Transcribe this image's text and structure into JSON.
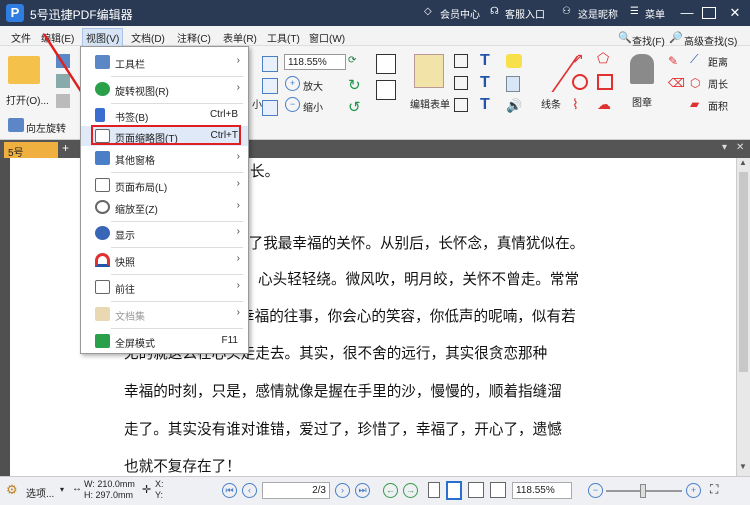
{
  "window": {
    "title": "5号迅捷PDF编辑器",
    "logo_letter": "P",
    "vip": "会员中心",
    "customer": "客服入口",
    "nickname": "这是昵称",
    "menu": "菜单"
  },
  "menubar": [
    "文件",
    "编辑(E)",
    "视图(V)",
    "文档(D)",
    "注释(C)",
    "表单(R)",
    "工具(T)",
    "窗口(W)"
  ],
  "ribbon": {
    "open": "打开(O)...",
    "zoom_value": "118.55%",
    "zoom_in": "放大",
    "zoom_out": "缩小",
    "edit_form": "编辑表单",
    "line": "线条",
    "stamp": "图章",
    "distance": "距离",
    "perimeter": "周长",
    "area": "面积",
    "find": "查找(F)",
    "advanced_find": "高级查找(S)",
    "rotate_left": "向左旋转",
    "small_label": "小"
  },
  "tab": {
    "name": "5号",
    "add": "+"
  },
  "document_lines": [
    "长。",
    "合了我最幸福的关怀。从别后，长怀念，真情犹似在。",
    "心头轻轻绕。微风吹，明月皎，关怀不曾走。常常",
    "幸福的往事，你会心的笑容，你低声的呢喃，似有若",
    "无的就这么在心头走走去。其实，很不舍的远行，其实很贪恋那种",
    "幸福的时刻，只是，感情就像是握在手里的沙，慢慢的，顺着指缝溜",
    "走了。其实没有谁对谁错，爱过了，珍惜了，幸福了，开心了，遗憾",
    "也就不复存在了！"
  ],
  "dropdown": {
    "items": [
      {
        "label": "工具栏",
        "shortcut": "",
        "arrow": "›"
      },
      {
        "label": "旋转视图(R)",
        "shortcut": "",
        "arrow": "›"
      },
      {
        "label": "书签(B)",
        "shortcut": "Ctrl+B",
        "arrow": ""
      },
      {
        "label": "页面缩略图(T)",
        "shortcut": "Ctrl+T",
        "arrow": ""
      },
      {
        "label": "其他窗格",
        "shortcut": "",
        "arrow": "›"
      },
      {
        "label": "页面布局(L)",
        "shortcut": "",
        "arrow": "›"
      },
      {
        "label": "缩放至(Z)",
        "shortcut": "",
        "arrow": "›"
      },
      {
        "label": "显示",
        "shortcut": "",
        "arrow": "›"
      },
      {
        "label": "快照",
        "shortcut": "",
        "arrow": "›"
      },
      {
        "label": "前往",
        "shortcut": "",
        "arrow": "›"
      },
      {
        "label": "文档集",
        "shortcut": "",
        "arrow": "›"
      },
      {
        "label": "全屏模式",
        "shortcut": "F11",
        "arrow": ""
      }
    ]
  },
  "statusbar": {
    "options": "选项...",
    "width": "W: 210.0mm",
    "height": "H: 297.0mm",
    "x": "X:",
    "y": "Y:",
    "page": "2",
    "page_total": "/3",
    "zoom": "118.55%"
  },
  "colors": {
    "titlebar": "#2a3a55",
    "accent": "#2f7de1",
    "highlight": "#e02020",
    "tab": "#f0b040"
  }
}
